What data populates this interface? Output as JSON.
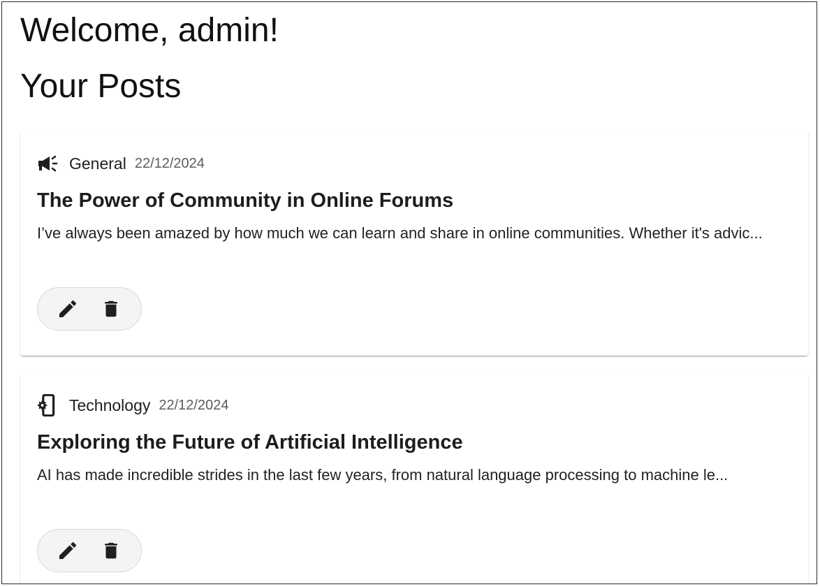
{
  "header": {
    "welcome": "Welcome, admin!",
    "section_title": "Your Posts"
  },
  "posts": [
    {
      "category": "General",
      "category_icon": "megaphone-icon",
      "date": "22/12/2024",
      "title": "The Power of Community in Online Forums",
      "excerpt": "I’ve always been amazed by how much we can learn and share in online communities. Whether it's advic...",
      "actions": [
        "edit-icon",
        "delete-icon"
      ]
    },
    {
      "category": "Technology",
      "category_icon": "device-settings-icon",
      "date": "22/12/2024",
      "title": "Exploring the Future of Artificial Intelligence",
      "excerpt": "AI has made incredible strides in the last few years, from natural language processing to machine le...",
      "actions": [
        "edit-icon",
        "delete-icon"
      ]
    }
  ],
  "colors": {
    "text": "#1f1f1f",
    "muted": "#5d5d5d",
    "action_bg": "#f4f4f4",
    "border": "#d8d8d8"
  }
}
